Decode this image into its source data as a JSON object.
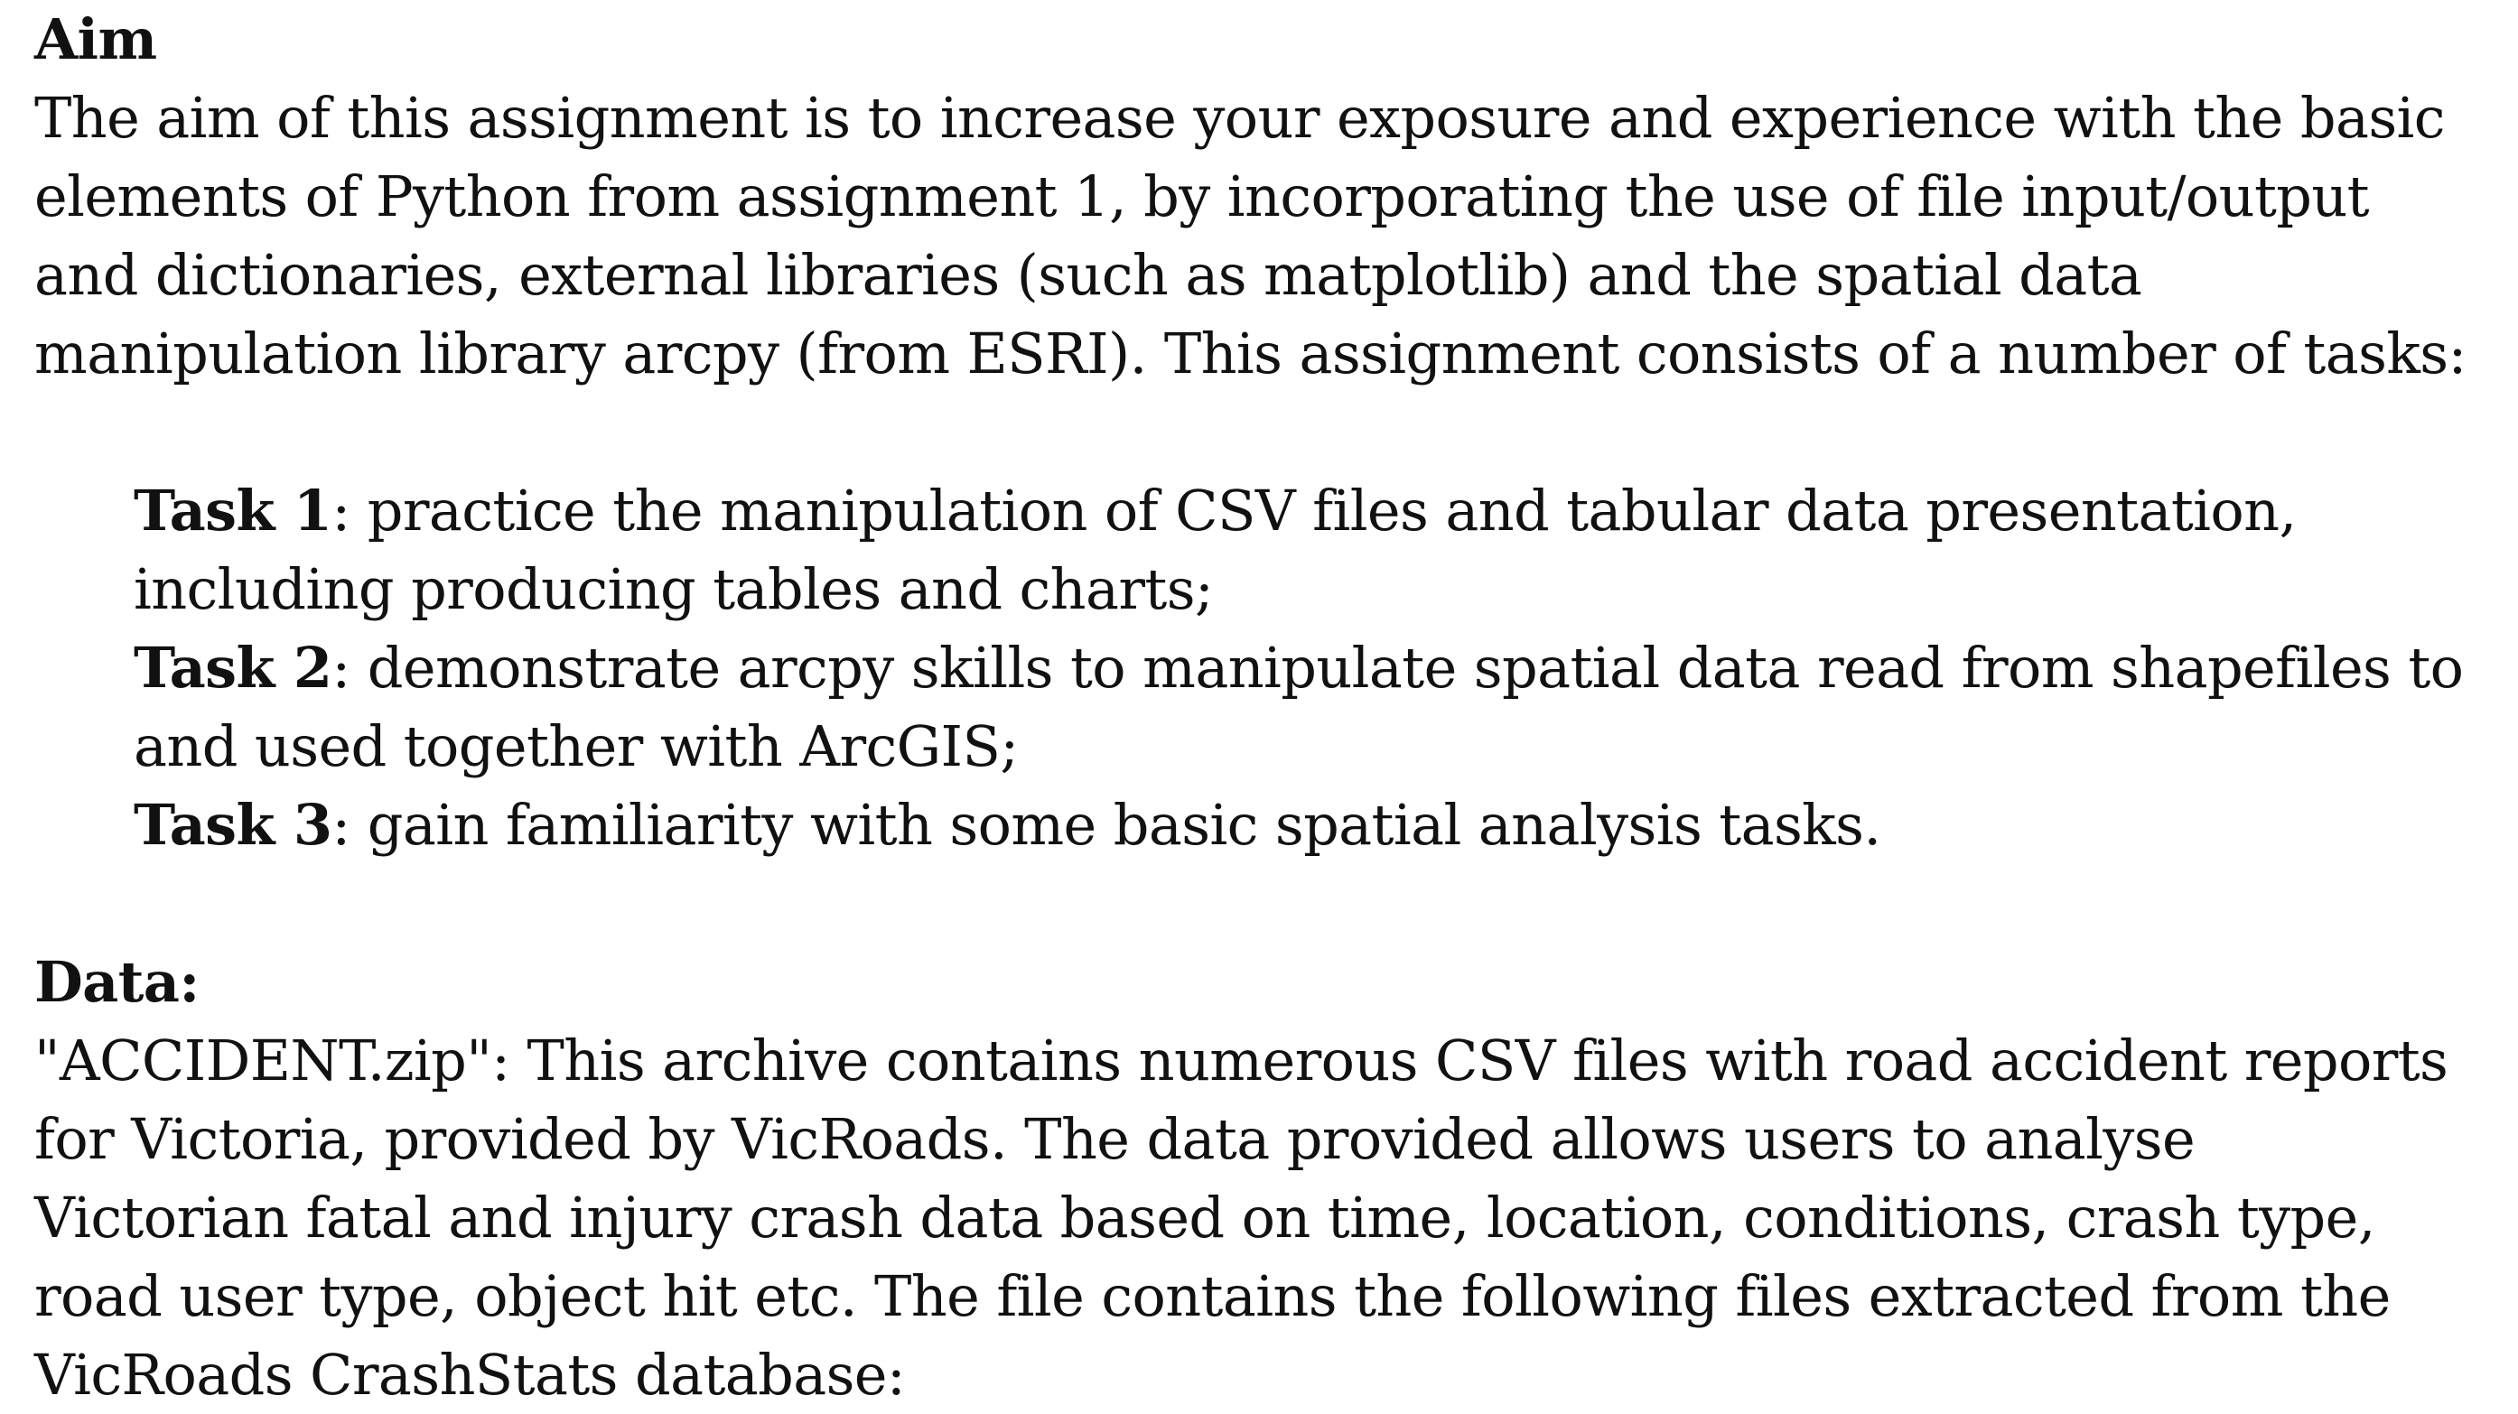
{
  "aim": {
    "heading": "Aim",
    "lines": [
      "The aim of this assignment is to increase your exposure and experience with the basic",
      "elements of Python from assignment 1, by incorporating the use of file input/output",
      "and dictionaries, external libraries (such as matplotlib) and the spatial data",
      "manipulation library arcpy (from ESRI). This assignment consists of a number of tasks:"
    ]
  },
  "tasks": [
    {
      "label": "Task 1",
      "lines": [
        ": practice the manipulation of CSV files and tabular data presentation,",
        "including producing tables and charts;"
      ]
    },
    {
      "label": "Task 2",
      "lines": [
        ": demonstrate arcpy skills to manipulate spatial data read from shapefiles to",
        "and used together with ArcGIS;"
      ]
    },
    {
      "label": "Task 3",
      "lines": [
        ": gain familiarity with some basic spatial analysis tasks."
      ]
    }
  ],
  "data_section": {
    "heading": "Data:",
    "lines": [
      "\"ACCIDENT.zip\": This archive contains numerous CSV files with road accident reports",
      "for Victoria, provided by VicRoads. The data provided allows users to analyse",
      "Victorian fatal and injury crash data based on time, location, conditions, crash type,",
      "road user type, object hit etc. The file contains the following files extracted from the",
      "VicRoads CrashStats database:"
    ]
  }
}
